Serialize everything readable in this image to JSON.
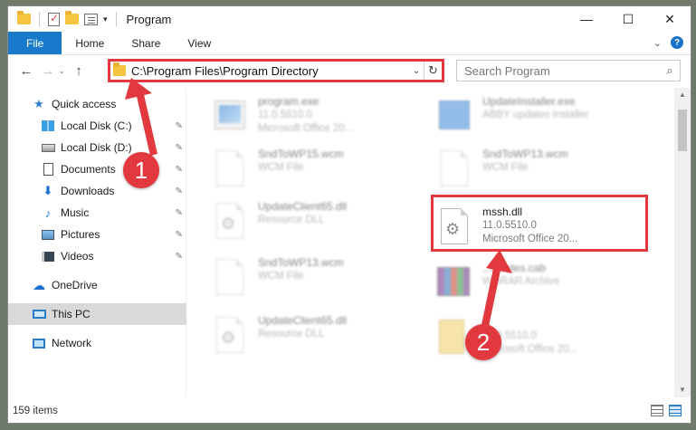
{
  "window": {
    "title": "Program",
    "controls": {
      "minimize": "—",
      "maximize": "☐",
      "close": "✕"
    }
  },
  "ribbon": {
    "tabs": [
      "File",
      "Home",
      "Share",
      "View"
    ],
    "expand_glyph": "⌄",
    "help_glyph": "?"
  },
  "nav": {
    "back": "←",
    "forward": "→",
    "recent": "⌄",
    "up": "↑",
    "address": "C:\\Program Files\\Program Directory",
    "address_drop": "⌄",
    "refresh": "↻",
    "search_placeholder": "Search Program",
    "search_icon": "⌕"
  },
  "sidebar": {
    "items": [
      {
        "label": "Quick access",
        "icon": "star-icon",
        "pinned": false
      },
      {
        "label": "Local Disk (C:)",
        "icon": "drive-c-icon",
        "pinned": true
      },
      {
        "label": "Local Disk (D:)",
        "icon": "drive-d-icon",
        "pinned": true
      },
      {
        "label": "Documents",
        "icon": "documents-icon",
        "pinned": true
      },
      {
        "label": "Downloads",
        "icon": "downloads-icon",
        "pinned": true
      },
      {
        "label": "Music",
        "icon": "music-icon",
        "pinned": true
      },
      {
        "label": "Pictures",
        "icon": "pictures-icon",
        "pinned": true
      },
      {
        "label": "Videos",
        "icon": "videos-icon",
        "pinned": true
      },
      {
        "label": "OneDrive",
        "icon": "onedrive-icon",
        "pinned": false
      },
      {
        "label": "This PC",
        "icon": "this-pc-icon",
        "pinned": false,
        "selected": true
      },
      {
        "label": "Network",
        "icon": "network-icon",
        "pinned": false
      }
    ],
    "pin_glyph": "📌"
  },
  "files": {
    "left": [
      {
        "name": "program.exe",
        "line2": "11.0.5510.0",
        "line3": "Microsoft Office 20..."
      },
      {
        "name": "SndToWP15.wcm",
        "line2": "WCM File"
      },
      {
        "name": "UpdateClient65.dll",
        "line2": "Resource DLL"
      },
      {
        "name": "SndToWP13.wcm",
        "line2": "WCM File"
      },
      {
        "name": "UpdateClient65.dll",
        "line2": "Resource DLL"
      }
    ],
    "right": [
      {
        "name": "UpdateInstaller.exe",
        "line2": "ABBY updates installer"
      },
      {
        "name": "SndToWP13.wcm",
        "line2": "WCM File"
      },
      {
        "name": "mssh.dll",
        "line2": "11.0.5510.0",
        "line3": "Microsoft Office 20...",
        "highlighted": true
      },
      {
        "name": "...ificates.cab",
        "line2": "WinRAR Archive"
      },
      {
        "name": "...",
        "line2": "11.0.5510.0",
        "line3": "Microsoft Office 20..."
      }
    ]
  },
  "status": {
    "count": "159 items"
  },
  "annotations": {
    "step1": "1",
    "step2": "2",
    "color": "#e1393e"
  },
  "colors": {
    "accent": "#1979ca",
    "annotation": "#e1393e"
  }
}
